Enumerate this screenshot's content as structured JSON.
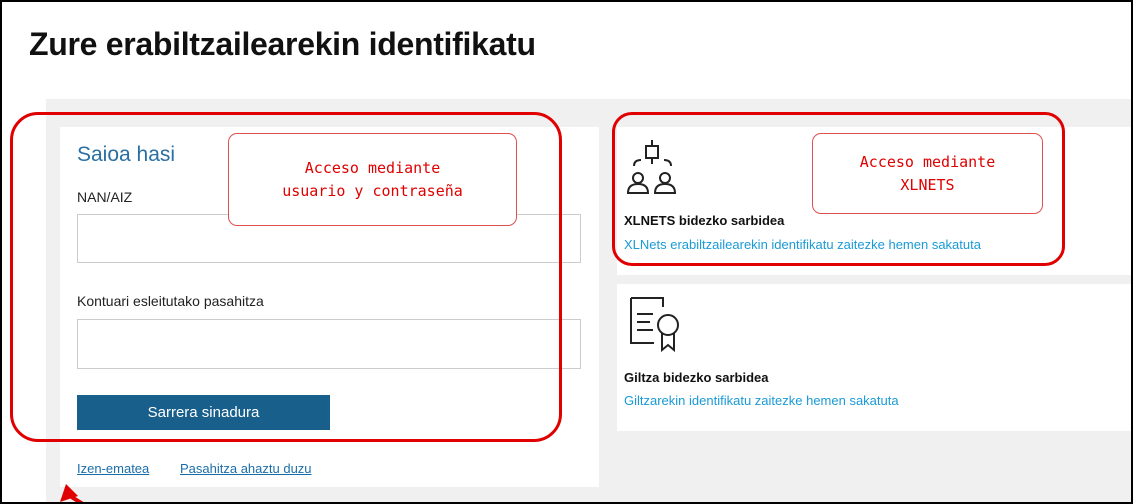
{
  "page": {
    "title": "Zure erabiltzailearekin identifikatu"
  },
  "login": {
    "title": "Saioa hasi",
    "user_label": "NAN/AIZ",
    "user_value": "",
    "password_label": "Kontuari esleitutako pasahitza",
    "password_value": "",
    "submit_label": "Sarrera sinadura",
    "register_link": "Izen-ematea",
    "forgot_link": "Pasahitza ahaztu duzu"
  },
  "xlnets": {
    "icon": "users-hierarchy-icon",
    "title": "XLNETS bidezko sarbidea",
    "link": "XLNets erabiltzailearekin identifikatu zaitezke hemen sakatuta"
  },
  "giltza": {
    "icon": "certificate-icon",
    "title": "Giltza bidezko sarbidea",
    "link": "Giltzarekin identifikatu zaitezke hemen sakatuta"
  },
  "annotations": {
    "login_line1": "Acceso mediante",
    "login_line2": "usuario y contraseña",
    "xl_line1": "Acceso mediante",
    "xl_line2": "XLNETS",
    "highlight_color": "#e00000"
  },
  "colors": {
    "title_blue": "#2a6fa3",
    "button_blue": "#185f8c",
    "link_blue": "#1a9ad6"
  }
}
